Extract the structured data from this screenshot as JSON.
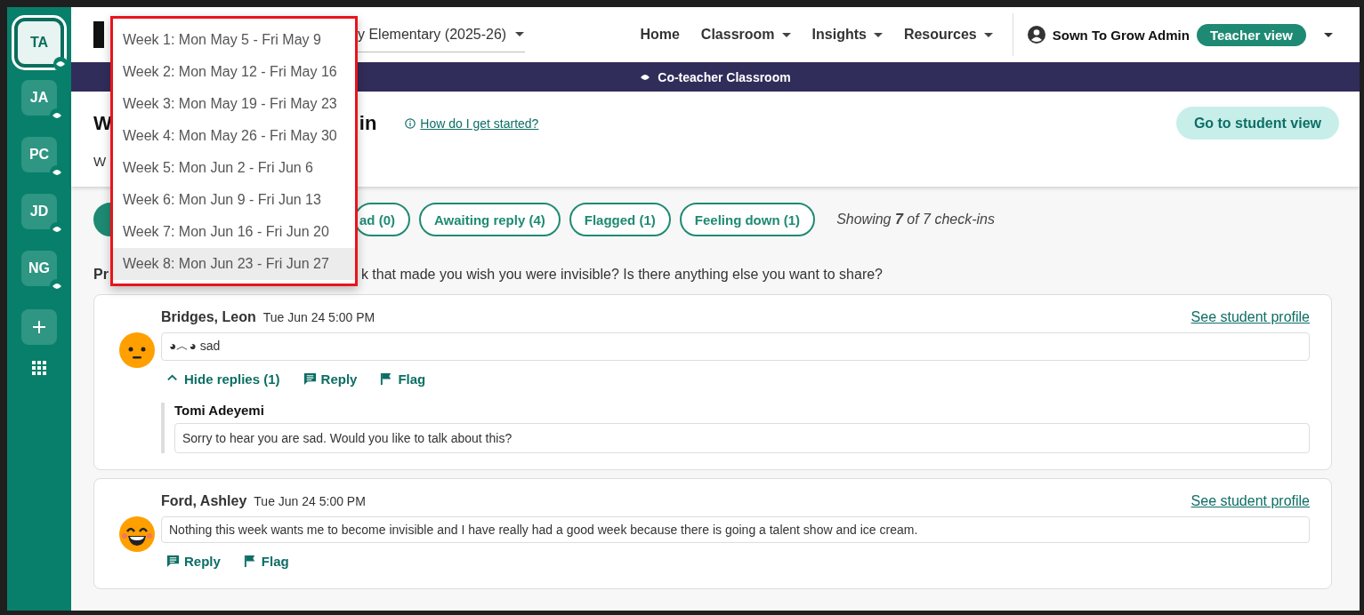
{
  "sidebar": {
    "classes": [
      {
        "initials": "TA",
        "selected": true
      },
      {
        "initials": "JA",
        "selected": false
      },
      {
        "initials": "PC",
        "selected": false
      },
      {
        "initials": "JD",
        "selected": false
      },
      {
        "initials": "NG",
        "selected": false
      }
    ]
  },
  "header": {
    "class_selector": {
      "value": "y Elementary (2025-26)"
    },
    "nav": [
      {
        "label": "Home",
        "has_menu": false
      },
      {
        "label": "Classroom",
        "has_menu": true
      },
      {
        "label": "Insights",
        "has_menu": true
      },
      {
        "label": "Resources",
        "has_menu": true
      }
    ],
    "user": {
      "name": "Sown To Grow Admin",
      "view_badge": "Teacher view"
    }
  },
  "banner": {
    "text": "Co-teacher Classroom"
  },
  "page": {
    "title_start": "W",
    "title_end": "in",
    "help_link": "How do I get started?",
    "subtitle": "W",
    "student_view_button": "Go to student view"
  },
  "filters": [
    {
      "selected": true
    },
    {
      "label": "ad (0)",
      "selected": false
    },
    {
      "label": "Awaiting reply (4)",
      "selected": false
    },
    {
      "label": "Flagged (1)",
      "selected": false
    },
    {
      "label": "Feeling down (1)",
      "selected": false
    }
  ],
  "showing": "Showing **7** of 7 check-ins",
  "prompt": {
    "label": "Pr",
    "text": "k that made you wish you were invisible? Is there anything else you want to share?"
  },
  "checkins": [
    {
      "name": "Bridges, Leon",
      "time": "Tue Jun 24 5:00 PM",
      "avatar": {
        "kind": "neutral"
      },
      "answer": "◕︿◕ sad",
      "profile_link": "See student profile",
      "actions": [
        {
          "kind": "toggle",
          "label": "Hide replies (1)"
        },
        {
          "kind": "reply",
          "label": "Reply"
        },
        {
          "kind": "flag",
          "label": "Flag"
        }
      ],
      "replies": [
        {
          "author": "Tomi Adeyemi",
          "text": "Sorry to hear you are sad. Would you like to talk about this?"
        }
      ]
    },
    {
      "name": "Ford, Ashley",
      "time": "Tue Jun 24 5:00 PM",
      "avatar": {
        "kind": "happy"
      },
      "answer": "Nothing this week wants me to become invisible and I have really had a good week because there is going a talent show and ice cream.",
      "profile_link": "See student profile",
      "actions": [
        {
          "kind": "reply",
          "label": "Reply"
        },
        {
          "kind": "flag",
          "label": "Flag"
        }
      ]
    }
  ],
  "week_menu": {
    "options": [
      {
        "label": "Week 1: Mon May 5 - Fri May 9",
        "selected": false
      },
      {
        "label": "Week 2: Mon May 12 - Fri May 16",
        "selected": false
      },
      {
        "label": "Week 3: Mon May 19 - Fri May 23",
        "selected": false
      },
      {
        "label": "Week 4: Mon May 26 - Fri May 30",
        "selected": false
      },
      {
        "label": "Week 5: Mon Jun 2 - Fri Jun 6",
        "selected": false
      },
      {
        "label": "Week 6: Mon Jun 9 - Fri Jun 13",
        "selected": false
      },
      {
        "label": "Week 7: Mon Jun 16 - Fri Jun 20",
        "selected": false
      },
      {
        "label": "Week 8: Mon Jun 23 - Fri Jun 27",
        "selected": true
      }
    ]
  }
}
